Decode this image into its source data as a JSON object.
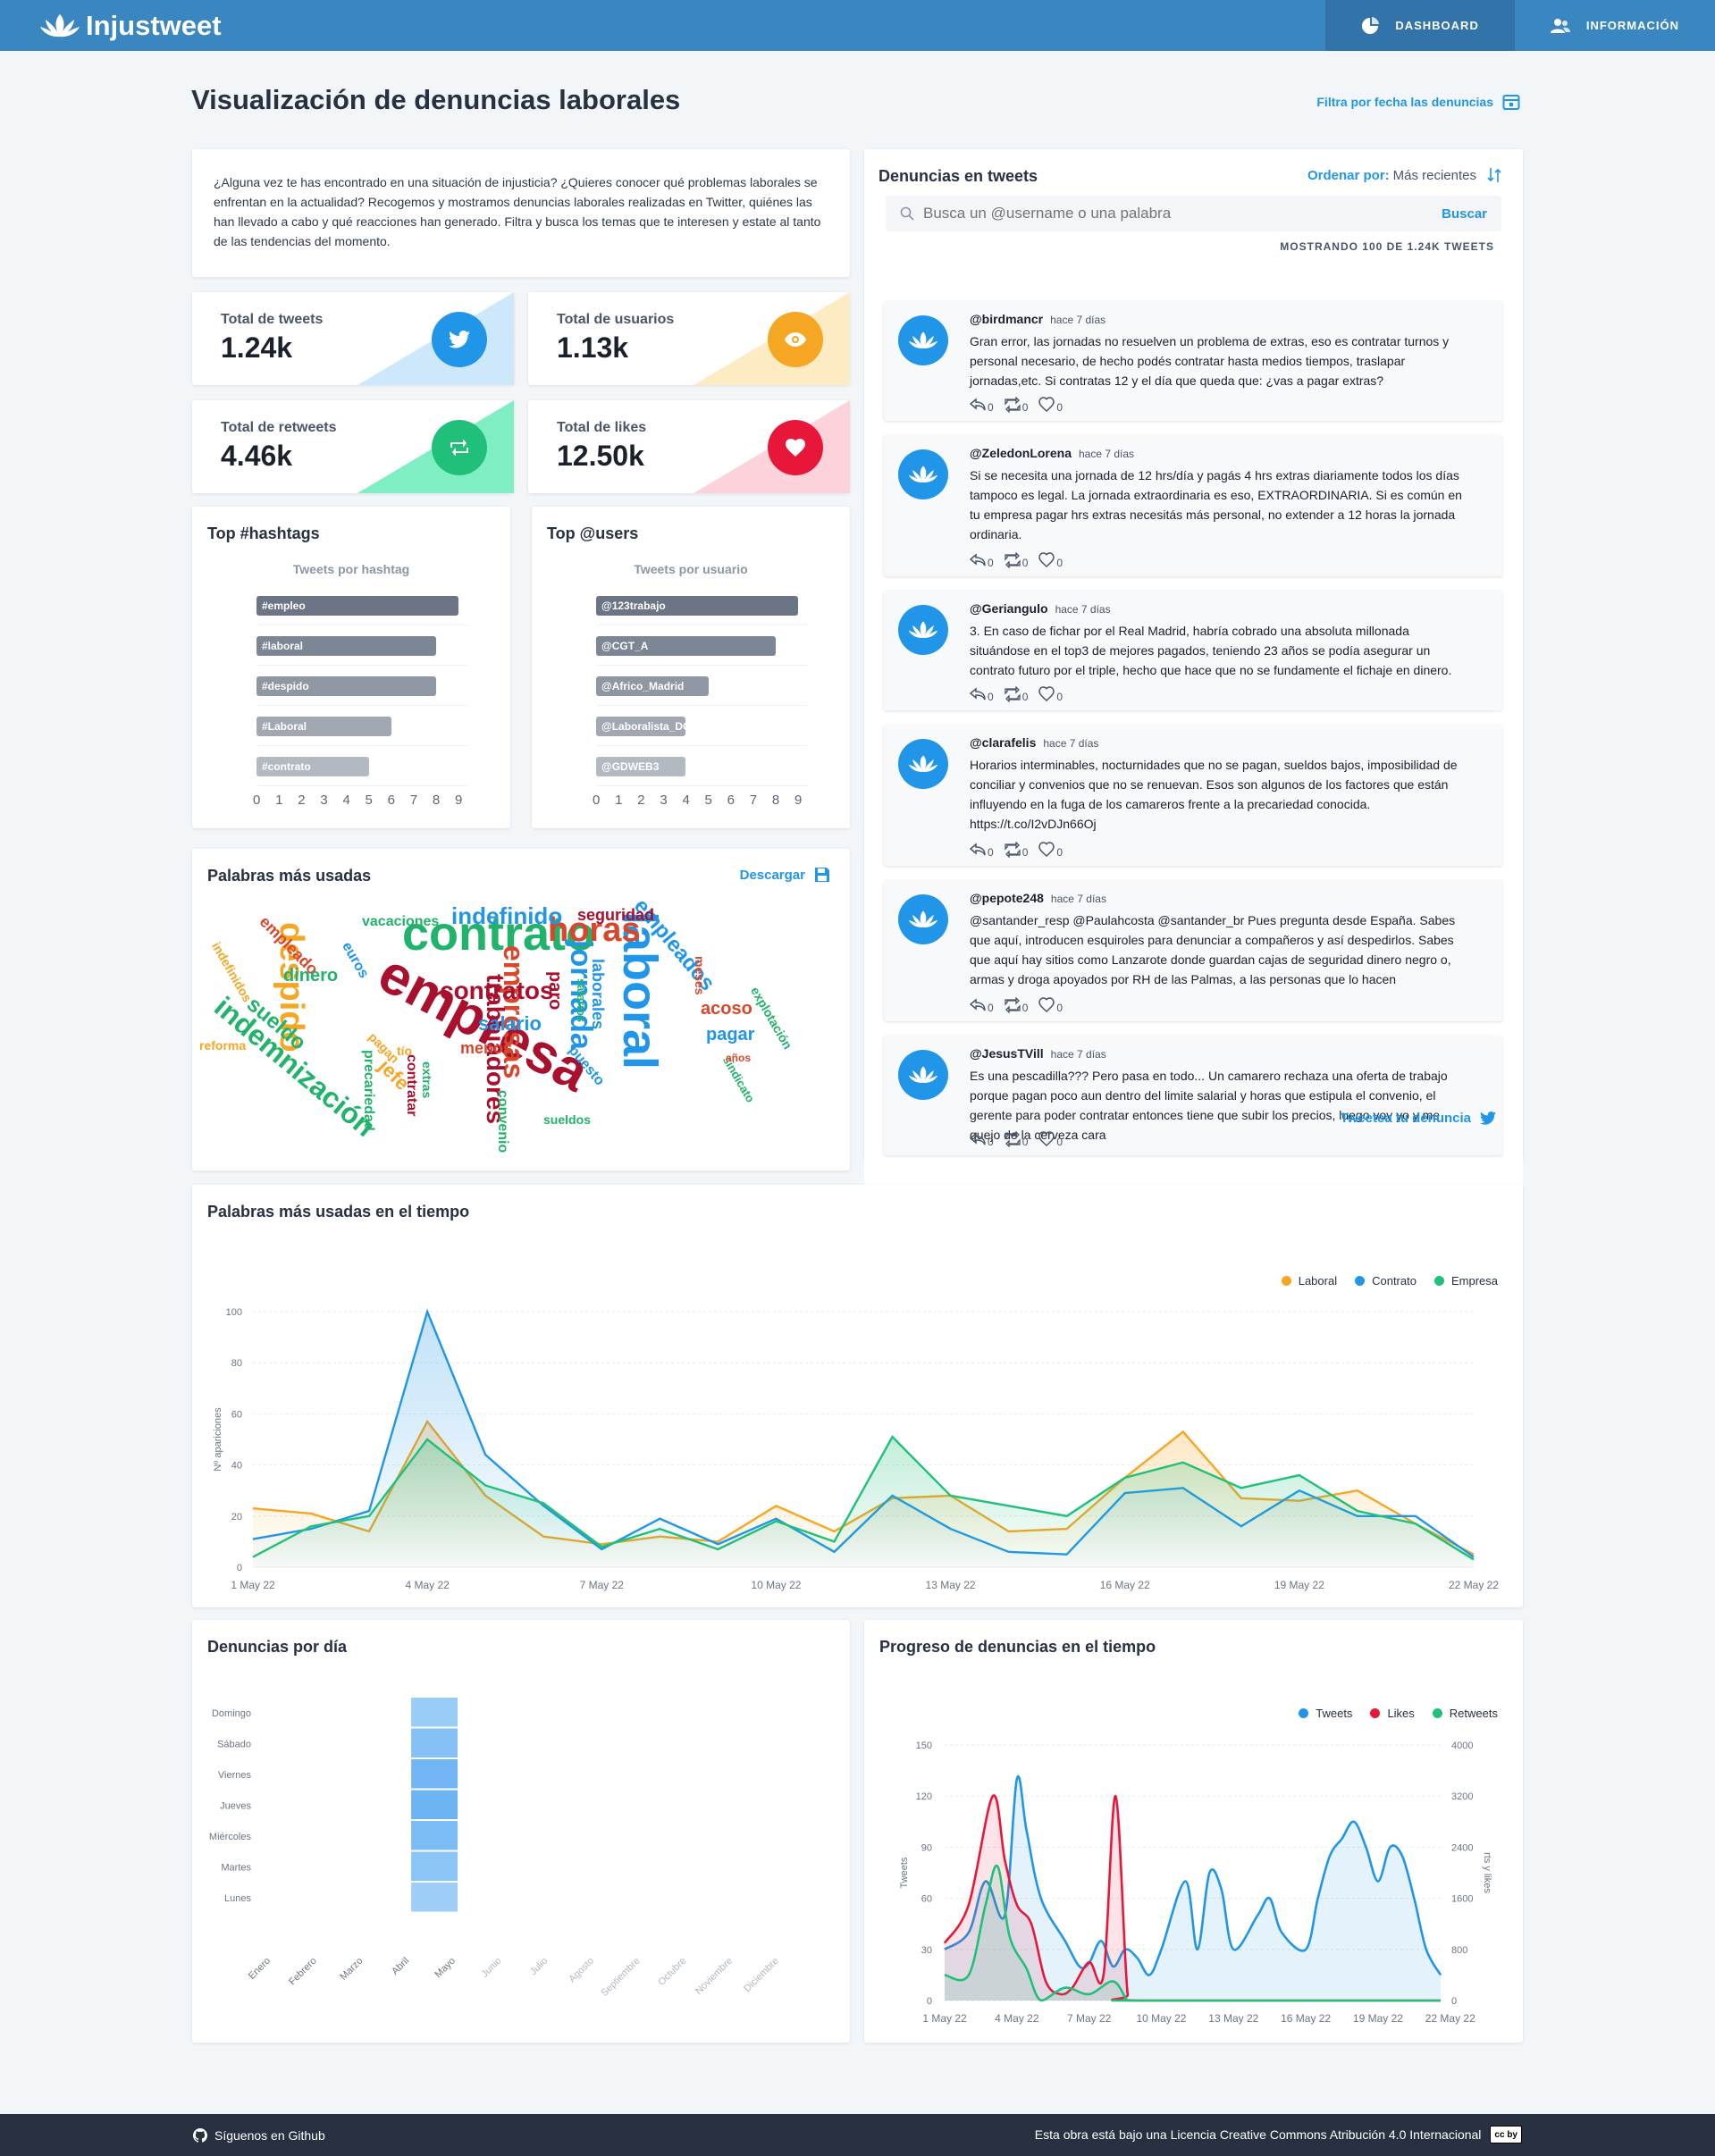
{
  "nav": {
    "brand": "Injustweet",
    "items": [
      {
        "label": "DASHBOARD",
        "icon": "pie-chart-icon",
        "active": true
      },
      {
        "label": "INFORMACIÓN",
        "icon": "users-icon",
        "active": false
      }
    ]
  },
  "page": {
    "title": "Visualización de denuncias laborales",
    "filter_label": "Filtra por fecha las denuncias"
  },
  "intro": {
    "text": "¿Alguna vez te has encontrado en una situación de injusticia? ¿Quieres conocer qué problemas laborales se enfrentan en la actualidad? Recogemos y mostramos denuncias laborales realizadas en Twitter, quiénes las han llevado a cabo y qué reacciones han generado. Filtra y busca los temas que te interesen y estate al tanto de las tendencias del momento."
  },
  "stats": [
    {
      "label": "Total de tweets",
      "value": "1.24k",
      "icon": "twitter-icon",
      "color": "#2196e8"
    },
    {
      "label": "Total de usuarios",
      "value": "1.13k",
      "icon": "eye-icon",
      "color": "#f5a623"
    },
    {
      "label": "Total de retweets",
      "value": "4.46k",
      "icon": "retweet-icon",
      "color": "#21c07a"
    },
    {
      "label": "Total de likes",
      "value": "12.50k",
      "icon": "heart-icon",
      "color": "#e8173a"
    }
  ],
  "top_hashtags": {
    "title": "Top #hashtags",
    "subtitle": "Tweets por hashtag",
    "ticks": [
      "0",
      "1",
      "2",
      "3",
      "4",
      "5",
      "6",
      "7",
      "8",
      "9"
    ],
    "chart_data": {
      "type": "bar",
      "categories": [
        "#empleo",
        "#laboral",
        "#despido",
        "#Laboral",
        "#contrato"
      ],
      "values": [
        9,
        8,
        8,
        6,
        5
      ],
      "xlim": [
        0,
        9
      ]
    }
  },
  "top_users": {
    "title": "Top @users",
    "subtitle": "Tweets por usuario",
    "ticks": [
      "0",
      "1",
      "2",
      "3",
      "4",
      "5",
      "6",
      "7",
      "8",
      "9"
    ],
    "chart_data": {
      "type": "bar",
      "categories": [
        "@123trabajo",
        "@CGT_A",
        "@Africo_Madrid",
        "@Laboralista_DGT",
        "@GDWEB3"
      ],
      "values": [
        9,
        8,
        5,
        4,
        4
      ],
      "xlim": [
        0,
        9
      ]
    }
  },
  "wordcloud": {
    "title": "Palabras más usadas",
    "download": "Descargar",
    "words": [
      {
        "text": "empresa",
        "color": "#a8102e"
      },
      {
        "text": "contrato",
        "color": "#21b36b"
      },
      {
        "text": "laboral",
        "color": "#2196e8"
      },
      {
        "text": "horas",
        "color": "#d9472b"
      },
      {
        "text": "despido",
        "color": "#f5a623"
      },
      {
        "text": "indemnización",
        "color": "#21b36b"
      },
      {
        "text": "jornada",
        "color": "#2196e8"
      },
      {
        "text": "empresas",
        "color": "#d9472b"
      },
      {
        "text": "contratos",
        "color": "#a8102e"
      },
      {
        "text": "trabajadores",
        "color": "#a8102e"
      },
      {
        "text": "indefinido",
        "color": "#2196e8"
      },
      {
        "text": "empleados",
        "color": "#2196e8"
      },
      {
        "text": "salario",
        "color": "#2196e8"
      },
      {
        "text": "acoso",
        "color": "#d9472b"
      },
      {
        "text": "pagar",
        "color": "#2196e8"
      },
      {
        "text": "sueldo",
        "color": "#21b36b"
      },
      {
        "text": "seguridad",
        "color": "#a8102e"
      },
      {
        "text": "empleado",
        "color": "#d9472b"
      },
      {
        "text": "dinero",
        "color": "#21b36b"
      },
      {
        "text": "laborales",
        "color": "#2196e8"
      },
      {
        "text": "vacaciones",
        "color": "#21b36b"
      },
      {
        "text": "euros",
        "color": "#2196e8"
      },
      {
        "text": "indefinidos",
        "color": "#f5a623"
      },
      {
        "text": "jefe",
        "color": "#f5a623"
      },
      {
        "text": "paro",
        "color": "#a8102e"
      },
      {
        "text": "menos",
        "color": "#d9472b"
      },
      {
        "text": "convenio",
        "color": "#21b36b"
      },
      {
        "text": "precariedad",
        "color": "#21b36b"
      },
      {
        "text": "contratar",
        "color": "#a8102e"
      },
      {
        "text": "puesto",
        "color": "#2196e8"
      },
      {
        "text": "extras",
        "color": "#21b36b"
      },
      {
        "text": "reforma",
        "color": "#f5a623"
      },
      {
        "text": "explotación",
        "color": "#21b36b"
      },
      {
        "text": "sindicato",
        "color": "#21b36b"
      },
      {
        "text": "años",
        "color": "#d9472b"
      },
      {
        "text": "meses",
        "color": "#d9472b"
      },
      {
        "text": "salarios",
        "color": "#21b36b"
      },
      {
        "text": "pagan",
        "color": "#f5a623"
      },
      {
        "text": "tío",
        "color": "#f5a623"
      },
      {
        "text": "sueldos",
        "color": "#21b36b"
      }
    ]
  },
  "tweets_panel": {
    "title": "Denuncias en tweets",
    "order_label": "Ordenar por:",
    "order_value": "Más recientes",
    "search_placeholder": "Busca un @username o una palabra",
    "search_button": "Buscar",
    "showing": "MOSTRANDO 100 DE 1.24K TWEETS",
    "cta": "Tweetea tu denuncia",
    "tweets": [
      {
        "user": "@birdmancr",
        "ago": "hace 7 días",
        "text": "Gran error, las jornadas no resuelven un problema de extras, eso es contratar turnos y personal necesario, de hecho podés contratar hasta medios tiempos, traslapar jornadas,etc. Si contratas 12 y el día que queda que: ¿vas a pagar extras?",
        "replies": "0",
        "retweets": "0",
        "likes": "0"
      },
      {
        "user": "@ZeledonLorena",
        "ago": "hace 7 días",
        "text": "Si se necesita una jornada de 12 hrs/día y pagás 4 hrs extras diariamente todos los días tampoco es legal. La jornada extraordinaria es eso, EXTRAORDINARIA. Si es común en tu empresa pagar hrs extras necesitás más personal, no extender a 12 horas la jornada ordinaria.",
        "replies": "0",
        "retweets": "0",
        "likes": "0"
      },
      {
        "user": "@Geriangulo",
        "ago": "hace 7 días",
        "text": "3. En caso de fichar por el Real Madrid, habría cobrado una absoluta millonada situándose en el top3 de mejores pagados, teniendo 23 años se podía asegurar un contrato futuro por el triple, hecho que hace que no se fundamente el fichaje en dinero.",
        "replies": "0",
        "retweets": "0",
        "likes": "0"
      },
      {
        "user": "@clarafelis",
        "ago": "hace 7 días",
        "text": "Horarios interminables, nocturnidades que no se pagan, sueldos bajos, imposibilidad de conciliar y convenios que no se renuevan. Esos son algunos de los factores que están influyendo en la fuga de los camareros frente a la precariedad conocida. https://t.co/I2vDJn66Oj",
        "replies": "0",
        "retweets": "0",
        "likes": "0"
      },
      {
        "user": "@pepote248",
        "ago": "hace 7 días",
        "text": "@santander_resp @Paulahcosta @santander_br Pues pregunta desde España. Sabes que aquí, introducen esquiroles para denunciar a compañeros y así despedirlos. Sabes que aquí hay sitios como Lanzarote donde guardan cajas de seguridad dinero negro o, armas y droga apoyados por RH de las Palmas, a las personas que lo hacen",
        "replies": "0",
        "retweets": "0",
        "likes": "0"
      },
      {
        "user": "@JesusTVill",
        "ago": "hace 7 días",
        "text": "Es una pescadilla??? Pero pasa en todo... Un camarero rechaza una oferta de trabajo porque pagan poco aun dentro del limite salarial y horas que estipula el convenio, el gerente para poder contratar entonces tiene que subir los precios, luego voy yo y me quejo de la cerveza cara",
        "replies": "0",
        "retweets": "0",
        "likes": "0"
      }
    ]
  },
  "words_time": {
    "title": "Palabras más usadas en el tiempo",
    "chart_data": {
      "type": "area",
      "ylabel": "Nº apariciones",
      "ylim": [
        0,
        100
      ],
      "yticks": [
        "0",
        "20",
        "40",
        "60",
        "80",
        "100"
      ],
      "x": [
        "1 May 22",
        "2 May 22",
        "3 May 22",
        "4 May 22",
        "5 May 22",
        "6 May 22",
        "7 May 22",
        "8 May 22",
        "9 May 22",
        "10 May 22",
        "11 May 22",
        "12 May 22",
        "13 May 22",
        "14 May 22",
        "15 May 22",
        "16 May 22",
        "17 May 22",
        "18 May 22",
        "19 May 22",
        "20 May 22",
        "21 May 22",
        "22 May 22"
      ],
      "xticks": [
        "1 May 22",
        "4 May 22",
        "7 May 22",
        "10 May 22",
        "13 May 22",
        "16 May 22",
        "19 May 22",
        "22 May 22"
      ],
      "series": [
        {
          "name": "Laboral",
          "color": "#f5a623",
          "values": [
            23,
            21,
            14,
            57,
            28,
            12,
            9,
            12,
            10,
            24,
            14,
            27,
            28,
            14,
            15,
            35,
            53,
            27,
            26,
            30,
            17,
            5
          ]
        },
        {
          "name": "Contrato",
          "color": "#2196e8",
          "values": [
            11,
            15,
            22,
            100,
            44,
            24,
            7,
            19,
            9,
            19,
            6,
            28,
            15,
            6,
            5,
            29,
            31,
            16,
            30,
            20,
            20,
            4
          ]
        },
        {
          "name": "Empresa",
          "color": "#21c07a",
          "values": [
            4,
            16,
            20,
            50,
            32,
            25,
            8,
            15,
            7,
            18,
            10,
            51,
            28,
            24,
            20,
            35,
            41,
            31,
            36,
            22,
            17,
            3
          ]
        }
      ]
    }
  },
  "per_day": {
    "title": "Denuncias por día",
    "chart_data": {
      "type": "heatmap",
      "y": [
        "Domingo",
        "Sábado",
        "Viernes",
        "Jueves",
        "Miércoles",
        "Martes",
        "Lunes"
      ],
      "x": [
        "Enero",
        "Febrero",
        "Marzo",
        "Abril",
        "Mayo",
        "Junio",
        "Julio",
        "Agosto",
        "Septiembre",
        "Octubre",
        "Noviembre",
        "Diciembre"
      ],
      "values_mayo": [
        0.35,
        0.55,
        0.75,
        0.8,
        0.65,
        0.5,
        0.3
      ]
    }
  },
  "progress": {
    "title": "Progreso de denuncias en el tiempo",
    "chart_data": {
      "type": "line",
      "ylabel_left": "Tweets",
      "ylabel_right": "rts y likes",
      "ylim_left": [
        0,
        150
      ],
      "ylim_right": [
        0,
        4000
      ],
      "yticks_left": [
        "0",
        "30",
        "60",
        "90",
        "120",
        "150"
      ],
      "yticks_right": [
        "0",
        "800",
        "1600",
        "2400",
        "3200",
        "4000"
      ],
      "xticks": [
        "1 May 22",
        "4 May 22",
        "7 May 22",
        "10 May 22",
        "13 May 22",
        "16 May 22",
        "19 May 22",
        "22 May 22"
      ],
      "series": [
        {
          "name": "Tweets",
          "color": "#2196e8",
          "axis": "left",
          "values": [
            [
              1,
              30
            ],
            [
              2,
              40
            ],
            [
              2.7,
              70
            ],
            [
              3.5,
              50
            ],
            [
              4,
              130
            ],
            [
              4.4,
              100
            ],
            [
              5,
              60
            ],
            [
              6,
              35
            ],
            [
              6.6,
              20
            ],
            [
              7,
              22
            ],
            [
              7.5,
              35
            ],
            [
              8,
              20
            ],
            [
              8.5,
              30
            ],
            [
              9,
              25
            ],
            [
              9.5,
              15
            ],
            [
              10,
              30
            ],
            [
              11,
              70
            ],
            [
              11.5,
              30
            ],
            [
              12,
              75
            ],
            [
              12.5,
              65
            ],
            [
              13,
              30
            ],
            [
              14,
              50
            ],
            [
              14.5,
              60
            ],
            [
              15,
              40
            ],
            [
              16,
              30
            ],
            [
              16.5,
              60
            ],
            [
              17,
              85
            ],
            [
              17.5,
              95
            ],
            [
              18,
              105
            ],
            [
              18.5,
              90
            ],
            [
              19,
              70
            ],
            [
              19.5,
              90
            ],
            [
              20,
              85
            ],
            [
              20.5,
              60
            ],
            [
              21,
              30
            ],
            [
              21.6,
              15
            ]
          ]
        },
        {
          "name": "Likes",
          "color": "#e8173a",
          "axis": "right",
          "values": [
            [
              1,
              900
            ],
            [
              2,
              1500
            ],
            [
              3,
              3200
            ],
            [
              3.5,
              2200
            ],
            [
              4,
              1500
            ],
            [
              4.6,
              1200
            ],
            [
              5.2,
              300
            ],
            [
              5.8,
              100
            ],
            [
              6.3,
              200
            ],
            [
              7,
              600
            ],
            [
              7.6,
              400
            ],
            [
              8.1,
              3200
            ],
            [
              8.6,
              100
            ],
            [
              9,
              0
            ],
            [
              21.6,
              0
            ]
          ]
        },
        {
          "name": "Retweets",
          "color": "#21c07a",
          "axis": "right",
          "values": [
            [
              1,
              400
            ],
            [
              2,
              400
            ],
            [
              2.7,
              1500
            ],
            [
              3.2,
              2100
            ],
            [
              3.7,
              1000
            ],
            [
              4.4,
              500
            ],
            [
              5,
              0
            ],
            [
              6,
              200
            ],
            [
              7,
              100
            ],
            [
              8,
              300
            ],
            [
              8.6,
              0
            ],
            [
              9,
              0
            ],
            [
              21.6,
              0
            ]
          ]
        }
      ]
    }
  },
  "footer": {
    "github": "Síguenos en Github",
    "license": "Esta obra está bajo una Licencia Creative Commons Atribución 4.0 Internacional",
    "cc_badge": "cc by"
  }
}
